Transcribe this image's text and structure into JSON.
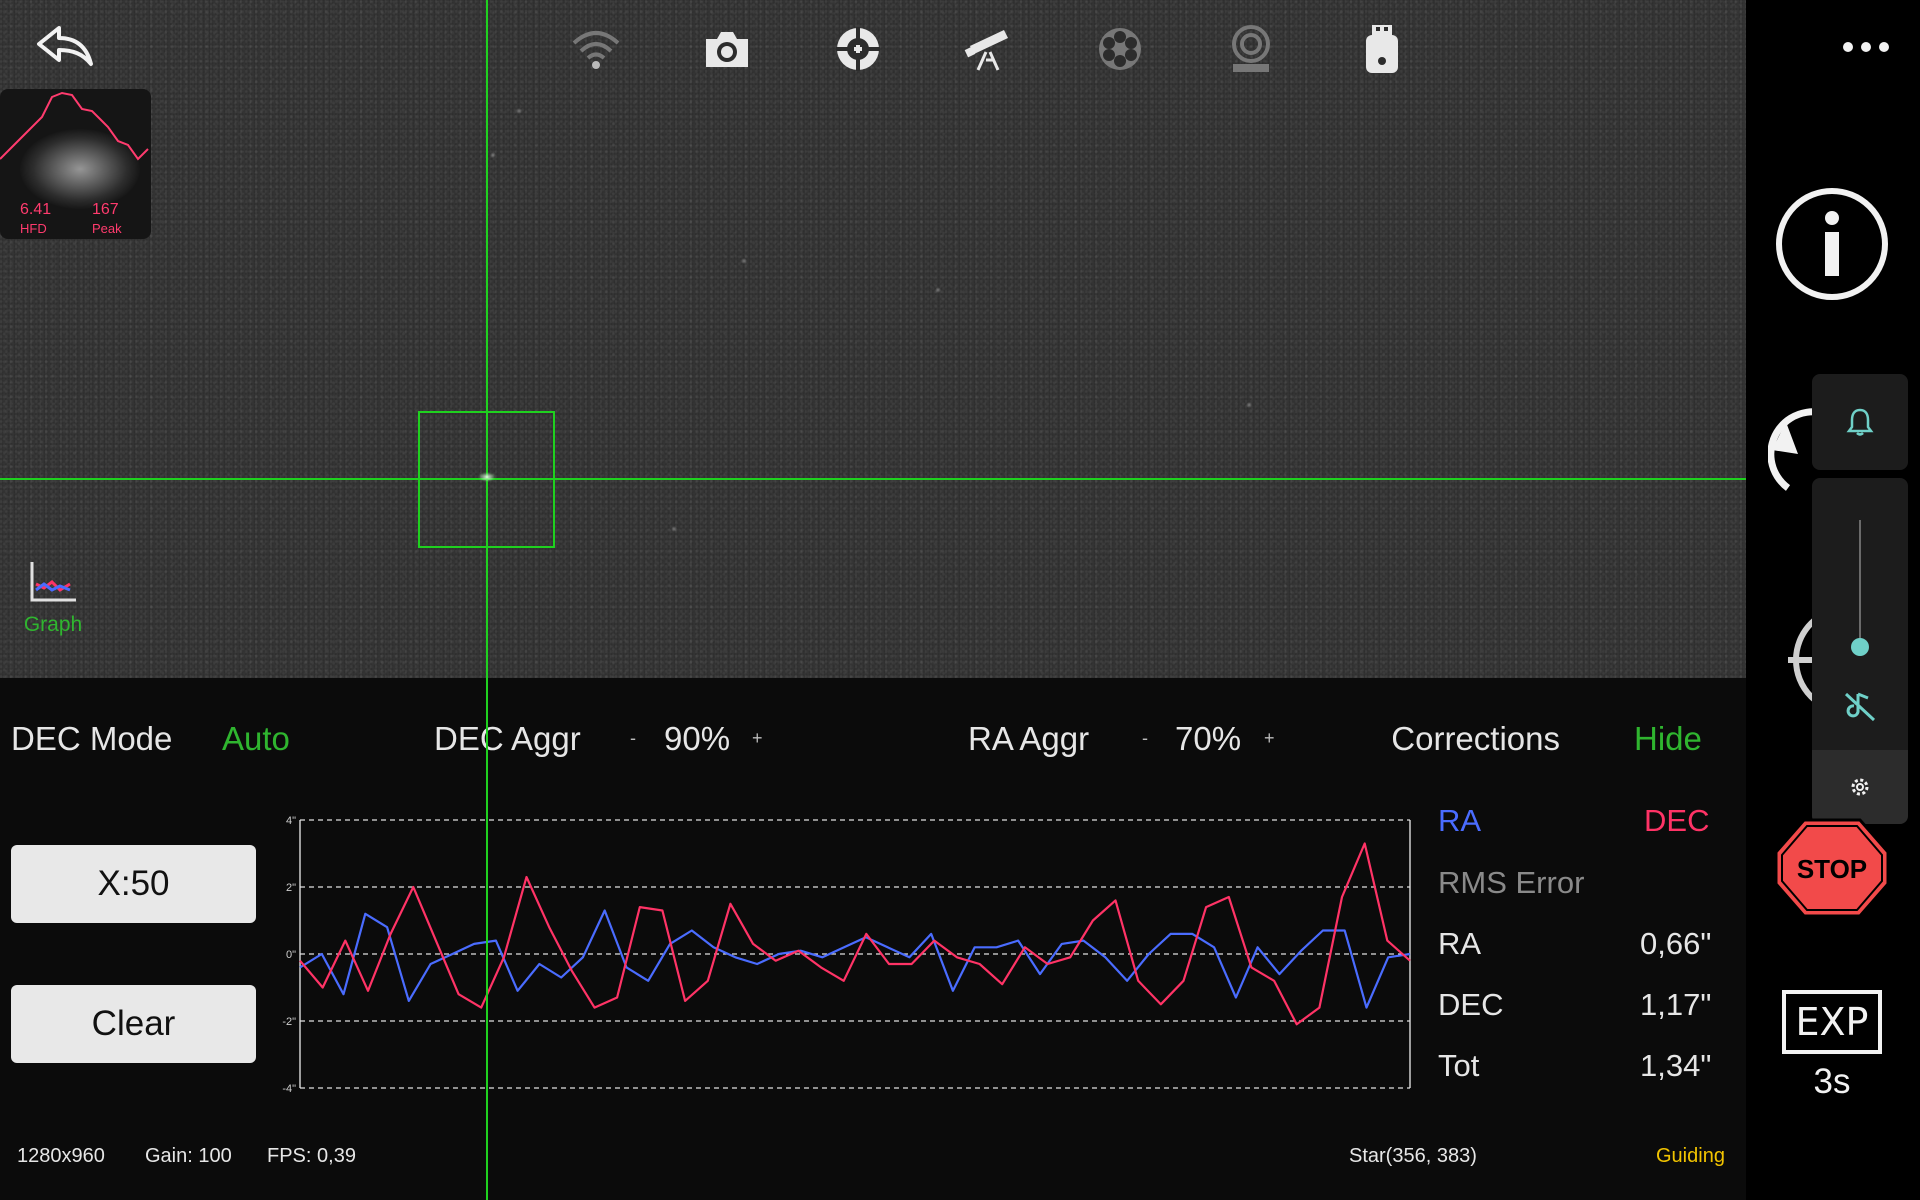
{
  "profile": {
    "hfd_value": "6.41",
    "hfd_label": "HFD",
    "peak_value": "167",
    "peak_label": "Peak"
  },
  "toolbar": {
    "icons": [
      "wifi-icon",
      "camera-icon",
      "guider-icon",
      "telescope-icon",
      "filter-wheel-icon",
      "focuser-icon",
      "usb-drive-icon"
    ]
  },
  "graph_toggle": {
    "label": "Graph"
  },
  "controls": {
    "dec_mode_label": "DEC Mode",
    "dec_mode_value": "Auto",
    "dec_aggr_label": "DEC Aggr",
    "dec_aggr_minus": "-",
    "dec_aggr_value": "90%",
    "dec_aggr_plus": "+",
    "ra_aggr_label": "RA Aggr",
    "ra_aggr_minus": "-",
    "ra_aggr_value": "70%",
    "ra_aggr_plus": "+",
    "corrections_label": "Corrections",
    "corrections_value": "Hide"
  },
  "buttons": {
    "scale_label": "X:50",
    "clear_label": "Clear"
  },
  "stats": {
    "legend_ra": "RA",
    "legend_dec": "DEC",
    "rms_title": "RMS Error",
    "ra_label": "RA",
    "ra_value": "0,66\"",
    "dec_label": "DEC",
    "dec_value": "1,17\"",
    "tot_label": "Tot",
    "tot_value": "1,34\""
  },
  "status": {
    "resolution": "1280x960",
    "gain": "Gain: 100",
    "fps": "FPS: 0,39",
    "star": "Star(356, 383)",
    "state": "Guiding"
  },
  "exposure": {
    "label": "EXP",
    "value": "3s"
  },
  "stop_label": "STOP",
  "colors": {
    "ra": "#4a6cff",
    "dec": "#ff3366",
    "accent_green": "#2fb52f",
    "guiding": "#f2c400",
    "stop": "#f24a4a"
  },
  "chart_data": {
    "type": "line",
    "ylim": [
      -4,
      4
    ],
    "ytick_labels": [
      "4\"",
      "2\"",
      "0\"",
      "-2\"",
      "-4\""
    ],
    "yticks": [
      4,
      2,
      0,
      -2,
      -4
    ],
    "series": [
      {
        "name": "RA",
        "values": [
          -0.4,
          0.0,
          -1.2,
          1.2,
          0.8,
          -1.4,
          -0.3,
          0.0,
          0.3,
          0.4,
          -1.1,
          -0.3,
          -0.7,
          -0.1,
          1.3,
          -0.4,
          -0.8,
          0.3,
          0.7,
          0.2,
          -0.1,
          -0.3,
          0.0,
          0.1,
          -0.1,
          0.2,
          0.5,
          0.2,
          -0.1,
          0.6,
          -1.1,
          0.2,
          0.2,
          0.4,
          -0.6,
          0.3,
          0.4,
          -0.1,
          -0.8,
          0.0,
          0.6,
          0.6,
          0.2,
          -1.3,
          0.2,
          -0.6,
          0.1,
          0.7,
          0.7,
          -1.6,
          -0.1,
          0.0
        ]
      },
      {
        "name": "DEC",
        "values": [
          -0.2,
          -1.0,
          0.4,
          -1.1,
          0.6,
          2.0,
          0.4,
          -1.2,
          -1.6,
          -0.1,
          2.3,
          0.8,
          -0.5,
          -1.6,
          -1.3,
          1.4,
          1.3,
          -1.4,
          -0.8,
          1.5,
          0.3,
          -0.2,
          0.1,
          -0.4,
          -0.8,
          0.6,
          -0.3,
          -0.3,
          0.4,
          -0.1,
          -0.3,
          -0.9,
          0.2,
          -0.3,
          -0.1,
          1.0,
          1.6,
          -0.8,
          -1.5,
          -0.8,
          1.4,
          1.7,
          -0.4,
          -0.8,
          -2.1,
          -1.6,
          1.7,
          3.3,
          0.4,
          -0.2
        ]
      }
    ]
  }
}
